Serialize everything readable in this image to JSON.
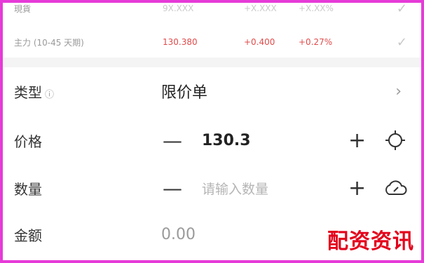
{
  "quotes": [
    {
      "name": "現貨",
      "price": "9X.XXX",
      "change": "+X.XXX",
      "pct": "+X.XX%"
    },
    {
      "name": "主力 (10-45 天期)",
      "price": "130.380",
      "change": "+0.400",
      "pct": "+0.27%"
    }
  ],
  "form": {
    "type_label": "类型",
    "type_value": "限价单",
    "price_label": "价格",
    "price_value": "130.3",
    "qty_label": "数量",
    "qty_placeholder": "请输入数量",
    "amount_label": "金额",
    "amount_value": "0.00"
  },
  "icons": {
    "check": "check-icon",
    "chevron": "chevron-right-icon",
    "crosshair": "crosshair-icon",
    "cloud": "cloud-icon",
    "info": "info-icon"
  },
  "colors": {
    "up": "#e04b4b",
    "frame": "#e63bd8",
    "watermark": "#e3001b"
  },
  "watermark": "配资资讯"
}
